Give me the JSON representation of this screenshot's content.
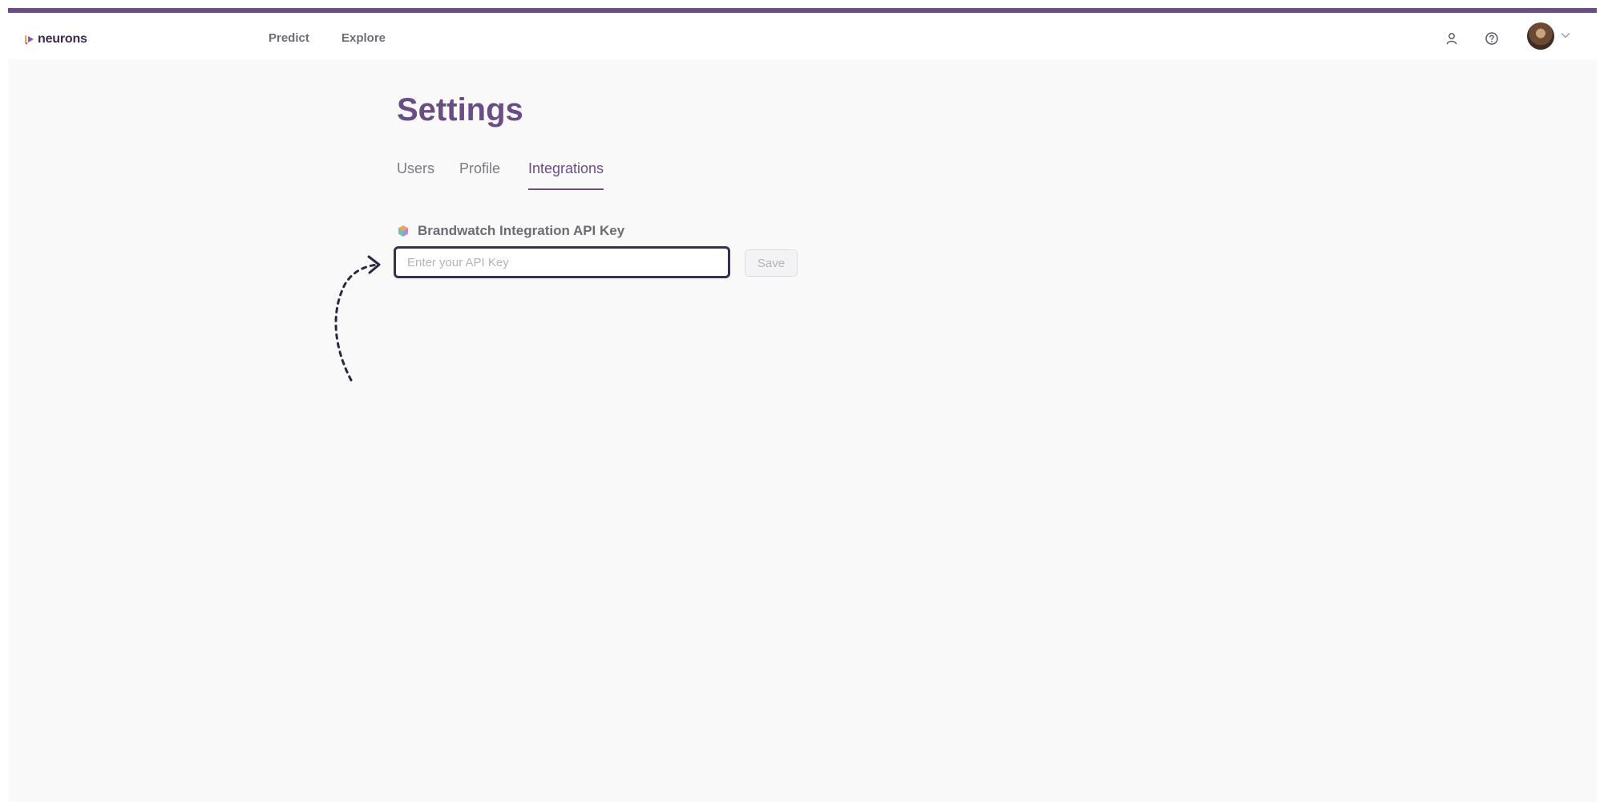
{
  "brand": {
    "name": "neurons"
  },
  "nav": {
    "links": [
      "Predict",
      "Explore"
    ]
  },
  "page": {
    "title": "Settings",
    "tabs": [
      {
        "label": "Users",
        "active": false
      },
      {
        "label": "Profile",
        "active": false
      },
      {
        "label": "Integrations",
        "active": true
      }
    ]
  },
  "integration": {
    "label": "Brandwatch Integration API Key",
    "input_value": "",
    "input_placeholder": "Enter your API Key",
    "save_label": "Save"
  },
  "colors": {
    "accent": "#6b4d86",
    "input_border": "#3a2f4c",
    "muted_text": "#7b7b84"
  },
  "icons": {
    "user": "user-icon",
    "help": "help-circle-icon",
    "chevron": "chevron-down-icon",
    "integration": "brandwatch-logo-icon"
  }
}
